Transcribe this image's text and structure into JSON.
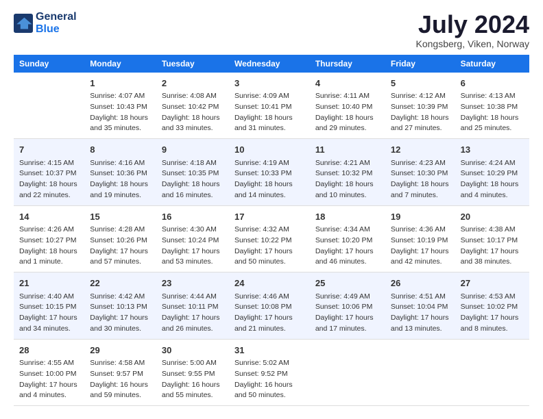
{
  "header": {
    "logo_line1": "General",
    "logo_line2": "Blue",
    "month_year": "July 2024",
    "location": "Kongsberg, Viken, Norway"
  },
  "days_of_week": [
    "Sunday",
    "Monday",
    "Tuesday",
    "Wednesday",
    "Thursday",
    "Friday",
    "Saturday"
  ],
  "weeks": [
    [
      {
        "day": "",
        "sunrise": "",
        "sunset": "",
        "daylight": ""
      },
      {
        "day": "1",
        "sunrise": "Sunrise: 4:07 AM",
        "sunset": "Sunset: 10:43 PM",
        "daylight": "Daylight: 18 hours and 35 minutes."
      },
      {
        "day": "2",
        "sunrise": "Sunrise: 4:08 AM",
        "sunset": "Sunset: 10:42 PM",
        "daylight": "Daylight: 18 hours and 33 minutes."
      },
      {
        "day": "3",
        "sunrise": "Sunrise: 4:09 AM",
        "sunset": "Sunset: 10:41 PM",
        "daylight": "Daylight: 18 hours and 31 minutes."
      },
      {
        "day": "4",
        "sunrise": "Sunrise: 4:11 AM",
        "sunset": "Sunset: 10:40 PM",
        "daylight": "Daylight: 18 hours and 29 minutes."
      },
      {
        "day": "5",
        "sunrise": "Sunrise: 4:12 AM",
        "sunset": "Sunset: 10:39 PM",
        "daylight": "Daylight: 18 hours and 27 minutes."
      },
      {
        "day": "6",
        "sunrise": "Sunrise: 4:13 AM",
        "sunset": "Sunset: 10:38 PM",
        "daylight": "Daylight: 18 hours and 25 minutes."
      }
    ],
    [
      {
        "day": "7",
        "sunrise": "Sunrise: 4:15 AM",
        "sunset": "Sunset: 10:37 PM",
        "daylight": "Daylight: 18 hours and 22 minutes."
      },
      {
        "day": "8",
        "sunrise": "Sunrise: 4:16 AM",
        "sunset": "Sunset: 10:36 PM",
        "daylight": "Daylight: 18 hours and 19 minutes."
      },
      {
        "day": "9",
        "sunrise": "Sunrise: 4:18 AM",
        "sunset": "Sunset: 10:35 PM",
        "daylight": "Daylight: 18 hours and 16 minutes."
      },
      {
        "day": "10",
        "sunrise": "Sunrise: 4:19 AM",
        "sunset": "Sunset: 10:33 PM",
        "daylight": "Daylight: 18 hours and 14 minutes."
      },
      {
        "day": "11",
        "sunrise": "Sunrise: 4:21 AM",
        "sunset": "Sunset: 10:32 PM",
        "daylight": "Daylight: 18 hours and 10 minutes."
      },
      {
        "day": "12",
        "sunrise": "Sunrise: 4:23 AM",
        "sunset": "Sunset: 10:30 PM",
        "daylight": "Daylight: 18 hours and 7 minutes."
      },
      {
        "day": "13",
        "sunrise": "Sunrise: 4:24 AM",
        "sunset": "Sunset: 10:29 PM",
        "daylight": "Daylight: 18 hours and 4 minutes."
      }
    ],
    [
      {
        "day": "14",
        "sunrise": "Sunrise: 4:26 AM",
        "sunset": "Sunset: 10:27 PM",
        "daylight": "Daylight: 18 hours and 1 minute."
      },
      {
        "day": "15",
        "sunrise": "Sunrise: 4:28 AM",
        "sunset": "Sunset: 10:26 PM",
        "daylight": "Daylight: 17 hours and 57 minutes."
      },
      {
        "day": "16",
        "sunrise": "Sunrise: 4:30 AM",
        "sunset": "Sunset: 10:24 PM",
        "daylight": "Daylight: 17 hours and 53 minutes."
      },
      {
        "day": "17",
        "sunrise": "Sunrise: 4:32 AM",
        "sunset": "Sunset: 10:22 PM",
        "daylight": "Daylight: 17 hours and 50 minutes."
      },
      {
        "day": "18",
        "sunrise": "Sunrise: 4:34 AM",
        "sunset": "Sunset: 10:20 PM",
        "daylight": "Daylight: 17 hours and 46 minutes."
      },
      {
        "day": "19",
        "sunrise": "Sunrise: 4:36 AM",
        "sunset": "Sunset: 10:19 PM",
        "daylight": "Daylight: 17 hours and 42 minutes."
      },
      {
        "day": "20",
        "sunrise": "Sunrise: 4:38 AM",
        "sunset": "Sunset: 10:17 PM",
        "daylight": "Daylight: 17 hours and 38 minutes."
      }
    ],
    [
      {
        "day": "21",
        "sunrise": "Sunrise: 4:40 AM",
        "sunset": "Sunset: 10:15 PM",
        "daylight": "Daylight: 17 hours and 34 minutes."
      },
      {
        "day": "22",
        "sunrise": "Sunrise: 4:42 AM",
        "sunset": "Sunset: 10:13 PM",
        "daylight": "Daylight: 17 hours and 30 minutes."
      },
      {
        "day": "23",
        "sunrise": "Sunrise: 4:44 AM",
        "sunset": "Sunset: 10:11 PM",
        "daylight": "Daylight: 17 hours and 26 minutes."
      },
      {
        "day": "24",
        "sunrise": "Sunrise: 4:46 AM",
        "sunset": "Sunset: 10:08 PM",
        "daylight": "Daylight: 17 hours and 21 minutes."
      },
      {
        "day": "25",
        "sunrise": "Sunrise: 4:49 AM",
        "sunset": "Sunset: 10:06 PM",
        "daylight": "Daylight: 17 hours and 17 minutes."
      },
      {
        "day": "26",
        "sunrise": "Sunrise: 4:51 AM",
        "sunset": "Sunset: 10:04 PM",
        "daylight": "Daylight: 17 hours and 13 minutes."
      },
      {
        "day": "27",
        "sunrise": "Sunrise: 4:53 AM",
        "sunset": "Sunset: 10:02 PM",
        "daylight": "Daylight: 17 hours and 8 minutes."
      }
    ],
    [
      {
        "day": "28",
        "sunrise": "Sunrise: 4:55 AM",
        "sunset": "Sunset: 10:00 PM",
        "daylight": "Daylight: 17 hours and 4 minutes."
      },
      {
        "day": "29",
        "sunrise": "Sunrise: 4:58 AM",
        "sunset": "Sunset: 9:57 PM",
        "daylight": "Daylight: 16 hours and 59 minutes."
      },
      {
        "day": "30",
        "sunrise": "Sunrise: 5:00 AM",
        "sunset": "Sunset: 9:55 PM",
        "daylight": "Daylight: 16 hours and 55 minutes."
      },
      {
        "day": "31",
        "sunrise": "Sunrise: 5:02 AM",
        "sunset": "Sunset: 9:52 PM",
        "daylight": "Daylight: 16 hours and 50 minutes."
      },
      {
        "day": "",
        "sunrise": "",
        "sunset": "",
        "daylight": ""
      },
      {
        "day": "",
        "sunrise": "",
        "sunset": "",
        "daylight": ""
      },
      {
        "day": "",
        "sunrise": "",
        "sunset": "",
        "daylight": ""
      }
    ]
  ]
}
